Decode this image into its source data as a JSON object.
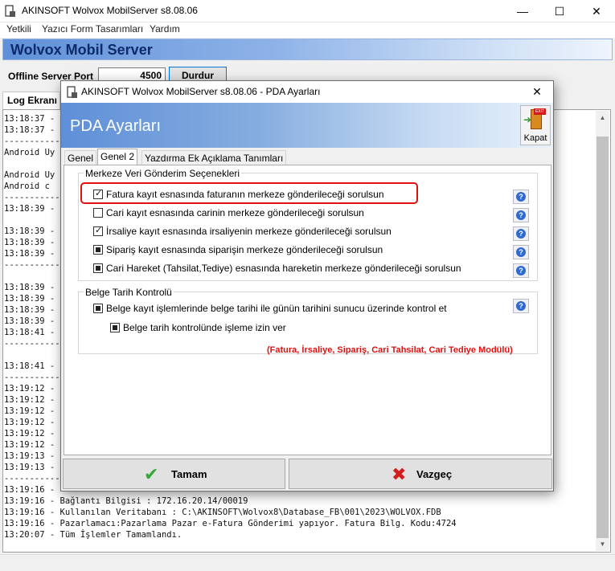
{
  "main_window": {
    "title": "AKINSOFT Wolvox MobilServer s8.08.06",
    "menu": [
      "Yetkili",
      "Yazıcı Form Tasarımları",
      "Yardım"
    ],
    "banner": "Wolvox Mobil Server",
    "port_label": "Offline Server Port",
    "port_value": "4500",
    "stop_button": "Durdur",
    "log_tab": "Log Ekranı",
    "controls": {
      "minimize": "—",
      "maximize": "☐",
      "close": "✕"
    }
  },
  "log_lines": [
    "13:18:37 -",
    "13:18:37 -",
    "------------",
    "Android Uy",
    "Android Uy",
    "Android c",
    "------------",
    "13:18:39 -",
    "13:18:39 -",
    "13:18:39 -",
    "13:18:39 -",
    "------------",
    "13:18:39 -",
    "13:18:39 -",
    "13:18:39 -",
    "13:18:39 -",
    "13:18:41 -",
    "------------",
    "13:18:41 -",
    "------------",
    "13:19:12 -",
    "13:19:12 -",
    "13:19:12 -",
    "13:19:12 -",
    "13:19:12 -",
    "13:19:12 -",
    "13:19:13 -",
    "13:19:13 -",
    "------------",
    "13:19:16 -",
    "13:19:16 - Bağlantı Bilgisi : 172.16.20.14/00019",
    "13:19:16 - Kullanılan Veritabanı : C:\\AKINSOFT\\Wolvox8\\Database_FB\\001\\2023\\WOLVOX.FDB",
    "13:19:16 - Pazarlamacı:Pazarlama Pazar e-Fatura Gönderimi yapıyor. Fatura Bilg. Kodu:4724",
    "13:20:07 - Tüm İşlemler Tamamlandı."
  ],
  "dialog": {
    "title": "AKINSOFT Wolvox MobilServer s8.08.06 - PDA Ayarları",
    "close_x": "✕",
    "heading": "PDA Ayarları",
    "close_button": "Kapat",
    "close_icon_text": "EXIT",
    "tabs": [
      "Genel",
      "Genel 2",
      "Yazdırma Ek Açıklama Tanımları"
    ],
    "active_tab": "Genel 2",
    "group1": {
      "title": "Merkeze Veri Gönderim Seçenekleri",
      "options": [
        {
          "label": "Fatura kayıt esnasında faturanın merkeze gönderileceği sorulsun",
          "state": "checked"
        },
        {
          "label": "Cari kayıt esnasında carinin merkeze gönderileceği sorulsun",
          "state": "unchecked"
        },
        {
          "label": "İrsaliye kayıt esnasında irsaliyenin merkeze gönderileceği sorulsun",
          "state": "checked"
        },
        {
          "label": "Sipariş kayıt esnasında siparişin merkeze gönderileceği sorulsun",
          "state": "filled"
        },
        {
          "label": "Cari Hareket (Tahsilat,Tediye) esnasında hareketin merkeze gönderileceği sorulsun",
          "state": "filled"
        }
      ]
    },
    "group2": {
      "title": "Belge Tarih Kontrolü",
      "options": [
        {
          "label": "Belge kayıt işlemlerinde belge tarihi ile günün tarihini sunucu üzerinde kontrol et",
          "state": "filled"
        },
        {
          "label": "Belge tarih kontrolünde işleme izin ver",
          "state": "filled"
        }
      ],
      "note": "(Fatura, İrsaliye, Sipariş, Cari Tahsilat, Cari Tediye Modülü)"
    },
    "ok_button": "Tamam",
    "cancel_button": "Vazgeç"
  },
  "colors": {
    "accent": "#0078d7",
    "highlight": "#e01010",
    "banner": "#5f8fd8"
  }
}
